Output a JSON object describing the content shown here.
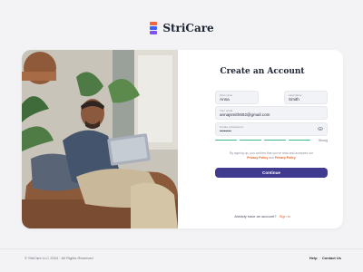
{
  "brand": {
    "name": "StriCare"
  },
  "form": {
    "title": "Create an Account",
    "first_name": {
      "label": "First name",
      "value": "Anna"
    },
    "last_name": {
      "label": "Last Name",
      "value": "Smith"
    },
    "email": {
      "label": "Your email",
      "value": "annajsmith602@gmail.com"
    },
    "password": {
      "label": "Create a Password",
      "value": "••••••••"
    },
    "strength_label": "Strong",
    "terms_prefix": "By signing up, you confirm that you've read and accepted our",
    "terms_link_privacy": "Privacy Policy",
    "terms_and": "and",
    "terms_link_policy": "Privacy Policy",
    "submit_label": "Continue",
    "signin_prompt": "Already have an account?",
    "signin_link": "Sign in"
  },
  "footer": {
    "copyright": "© StriCare LLC 2024 · All Rights Reserved",
    "links": [
      "Help",
      "Contact Us"
    ],
    "separator": "·"
  },
  "colors": {
    "accent": "#403b8f",
    "link": "#e3672b",
    "strength": "#3bb886",
    "background": "#f3f3f5"
  }
}
